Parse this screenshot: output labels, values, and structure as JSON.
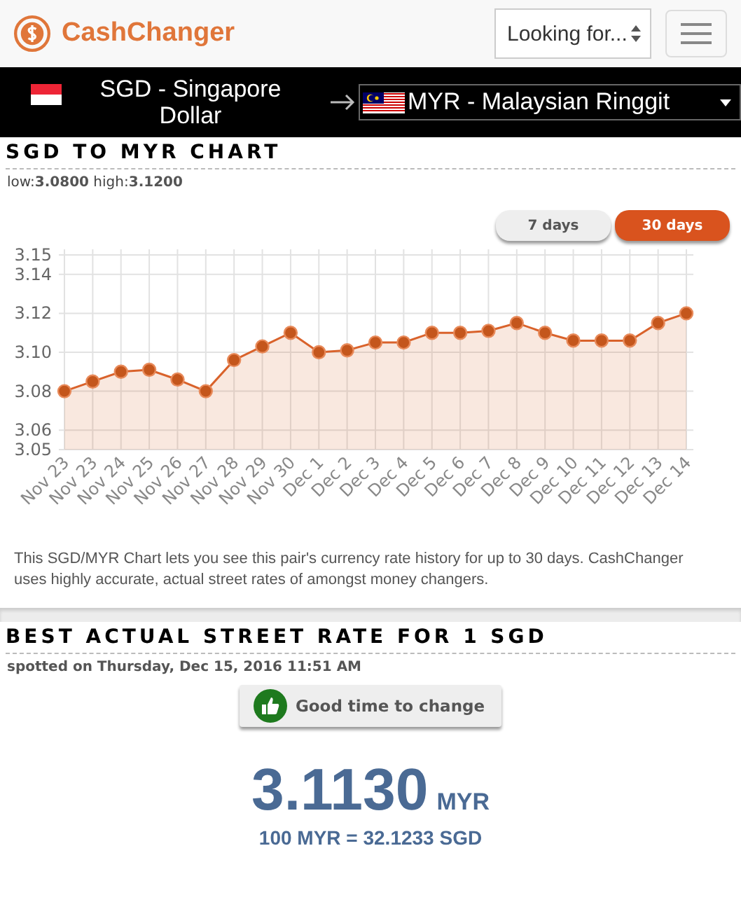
{
  "header": {
    "logo": "CashChanger",
    "search_select": {
      "placeholder": "Looking for..."
    }
  },
  "currency_bar": {
    "from": "SGD - Singapore Dollar",
    "to": "MYR - Malaysian Ringgit"
  },
  "chart_section": {
    "title": "SGD TO MYR CHART",
    "low_label": "low:",
    "low": "3.0800",
    "high_label": "high:",
    "high": "3.1200",
    "ranges": [
      {
        "label": "7 days",
        "selected": false
      },
      {
        "label": "30 days",
        "selected": true
      }
    ],
    "chart_data": {
      "type": "area",
      "categories": [
        "Nov 23",
        "Nov 23",
        "Nov 24",
        "Nov 25",
        "Nov 26",
        "Nov 27",
        "Nov 28",
        "Nov 29",
        "Nov 30",
        "Dec 1",
        "Dec 2",
        "Dec 3",
        "Dec 4",
        "Dec 5",
        "Dec 6",
        "Dec 7",
        "Dec 8",
        "Dec 9",
        "Dec 10",
        "Dec 11",
        "Dec 12",
        "Dec 13",
        "Dec 14"
      ],
      "grid": true,
      "series": [
        {
          "color": "#d9622b",
          "values": [
            3.08,
            3.085,
            3.09,
            3.091,
            3.086,
            3.08,
            3.096,
            3.103,
            3.11,
            3.1,
            3.101,
            3.105,
            3.105,
            3.11,
            3.11,
            3.111,
            3.115,
            3.11,
            3.106,
            3.106,
            3.106,
            3.115,
            3.12
          ]
        }
      ],
      "ylim": [
        3.05,
        3.15
      ],
      "yticks": [
        3.05,
        3.06,
        {
          "value": 3.08,
          "label": "3.08"
        },
        {
          "value": 3.1,
          "label": "3.10"
        },
        {
          "value": 3.12,
          "label": "3.12"
        },
        3.14,
        3.15
      ]
    },
    "description": "This SGD/MYR Chart lets you see this pair's currency rate history for up to 30 days. CashChanger uses highly accurate, actual street rates of amongst money changers."
  },
  "rate_section": {
    "title": "BEST ACTUAL STREET RATE FOR 1 SGD",
    "spotted": "spotted on Thursday, Dec 15, 2016 11:51 AM",
    "advice": "Good time to change",
    "rate": "3.1130",
    "rate_unit": "MYR",
    "inverse": "100 MYR = 32.1233 SGD"
  }
}
